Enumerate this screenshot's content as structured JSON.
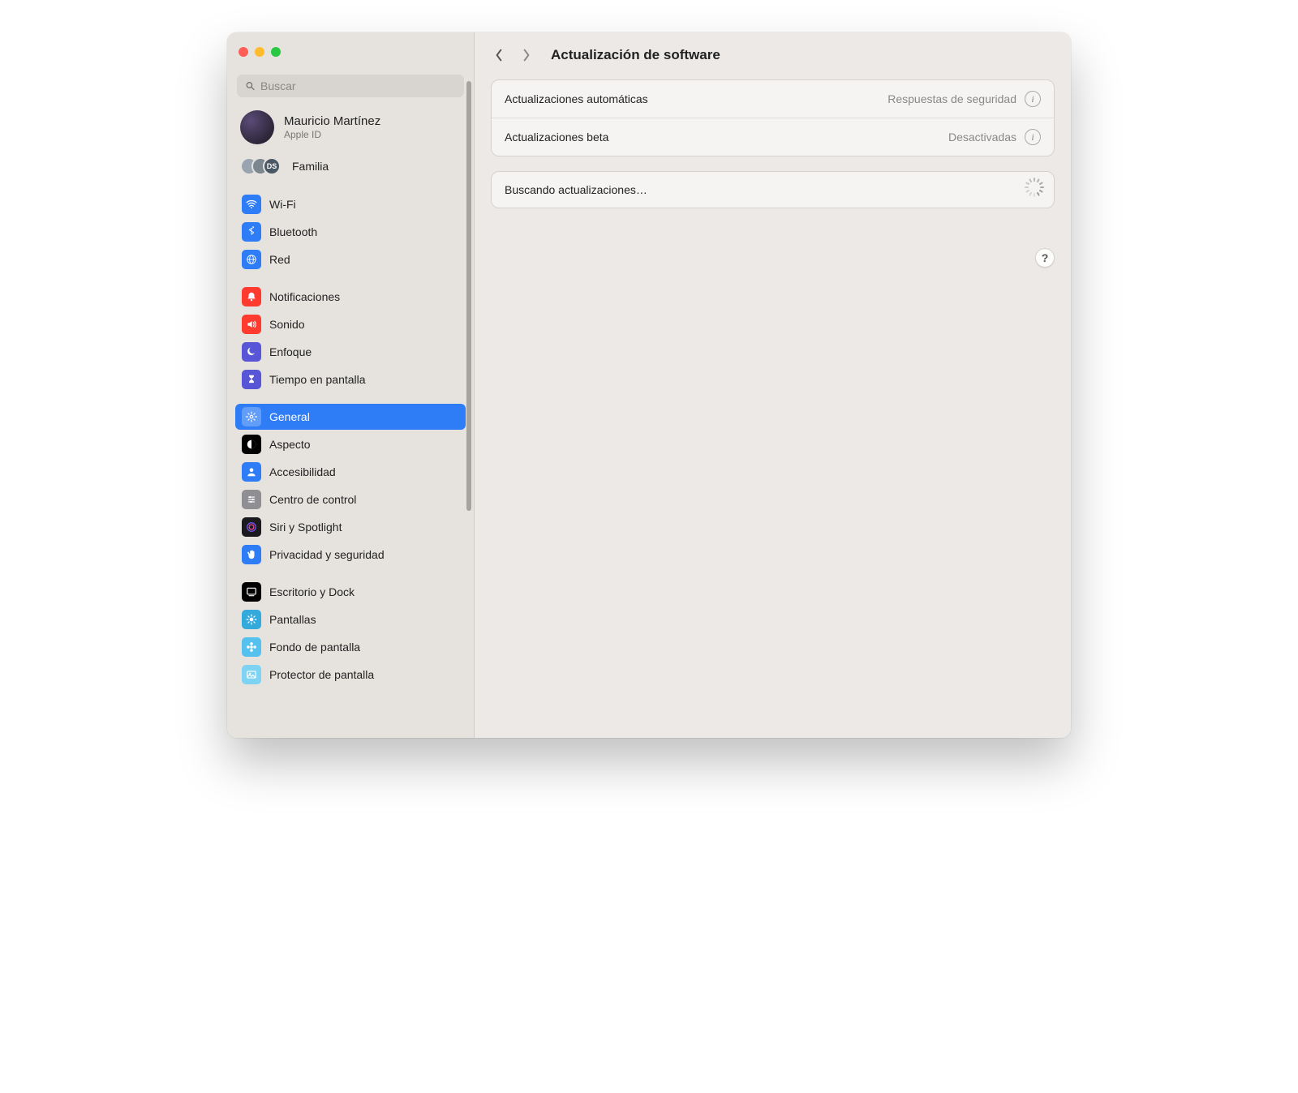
{
  "search": {
    "placeholder": "Buscar"
  },
  "account": {
    "name": "Mauricio Martínez",
    "sub": "Apple ID"
  },
  "family": {
    "label": "Familia",
    "badge": "DS"
  },
  "sidebar": {
    "groups": [
      [
        {
          "key": "wifi",
          "label": "Wi-Fi",
          "bg": "#2e7cf6",
          "icon": "wifi"
        },
        {
          "key": "bluetooth",
          "label": "Bluetooth",
          "bg": "#2e7cf6",
          "icon": "bluetooth"
        },
        {
          "key": "network",
          "label": "Red",
          "bg": "#2e7cf6",
          "icon": "globe"
        }
      ],
      [
        {
          "key": "notifications",
          "label": "Notificaciones",
          "bg": "#ff3b30",
          "icon": "bell"
        },
        {
          "key": "sound",
          "label": "Sonido",
          "bg": "#ff3b30",
          "icon": "speaker"
        },
        {
          "key": "focus",
          "label": "Enfoque",
          "bg": "#5856d6",
          "icon": "moon"
        },
        {
          "key": "screentime",
          "label": "Tiempo en pantalla",
          "bg": "#5856d6",
          "icon": "hourglass"
        }
      ],
      [
        {
          "key": "general",
          "label": "General",
          "bg": "#8e8e93",
          "icon": "gear",
          "selected": true
        },
        {
          "key": "appearance",
          "label": "Aspecto",
          "bg": "#000000",
          "icon": "contrast"
        },
        {
          "key": "accessibility",
          "label": "Accesibilidad",
          "bg": "#2e7cf6",
          "icon": "person"
        },
        {
          "key": "controlcenter",
          "label": "Centro de control",
          "bg": "#8e8e93",
          "icon": "sliders"
        },
        {
          "key": "siri",
          "label": "Siri y Spotlight",
          "bg": "#1b1b1f",
          "icon": "siri"
        },
        {
          "key": "privacy",
          "label": "Privacidad y seguridad",
          "bg": "#2e7cf6",
          "icon": "hand"
        }
      ],
      [
        {
          "key": "desktop",
          "label": "Escritorio y Dock",
          "bg": "#000000",
          "icon": "dock"
        },
        {
          "key": "displays",
          "label": "Pantallas",
          "bg": "#34aadc",
          "icon": "sun"
        },
        {
          "key": "wallpaper",
          "label": "Fondo de pantalla",
          "bg": "#55c1ef",
          "icon": "flower"
        },
        {
          "key": "screensaver",
          "label": "Protector de pantalla",
          "bg": "#7ed3f3",
          "icon": "photo"
        }
      ]
    ]
  },
  "header": {
    "title": "Actualización de software"
  },
  "rows": {
    "auto": {
      "label": "Actualizaciones automáticas",
      "value": "Respuestas de seguridad"
    },
    "beta": {
      "label": "Actualizaciones beta",
      "value": "Desactivadas"
    },
    "checking": {
      "label": "Buscando actualizaciones…"
    }
  },
  "help": "?"
}
